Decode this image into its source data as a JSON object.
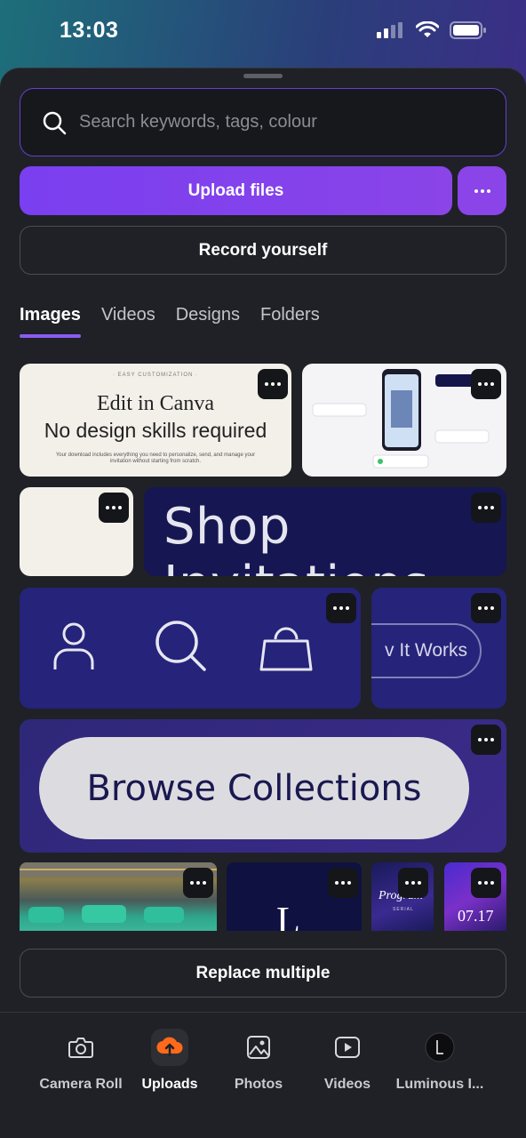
{
  "status_bar": {
    "time": "13:03"
  },
  "search": {
    "placeholder": "Search keywords, tags, colour"
  },
  "actions": {
    "upload_label": "Upload files",
    "record_label": "Record yourself",
    "replace_label": "Replace multiple"
  },
  "tabs": [
    {
      "label": "Images",
      "active": true
    },
    {
      "label": "Videos",
      "active": false
    },
    {
      "label": "Designs",
      "active": false
    },
    {
      "label": "Folders",
      "active": false
    }
  ],
  "thumbnails": {
    "t1": {
      "eyebrow": "· EASY CUSTOMIZATION ·",
      "headline": "Edit in Canva",
      "headline2": "No design skills required",
      "small": "Your download includes everything you need to personalize, send, and manage your invitation without starting from scratch."
    },
    "t4": {
      "text": "Shop Invitations"
    },
    "t6": {
      "text": "v It Works"
    },
    "t7": {
      "text": "Browse Collections"
    },
    "t9": {
      "text": "L"
    },
    "t10": {
      "script": "Program",
      "tiny": "SERIAL"
    },
    "t11": {
      "date": "07.17"
    }
  },
  "bottom_nav": [
    {
      "label": "Camera Roll",
      "icon": "camera-icon",
      "active": false
    },
    {
      "label": "Uploads",
      "icon": "upload-cloud-icon",
      "active": true
    },
    {
      "label": "Photos",
      "icon": "photo-icon",
      "active": false
    },
    {
      "label": "Videos",
      "icon": "video-play-icon",
      "active": false
    },
    {
      "label": "Luminous I...",
      "icon": "brand-logo-icon",
      "active": false
    }
  ],
  "colors": {
    "accent": "#8a44e8",
    "sheet_bg": "#1f2126",
    "upload_icon": "#ff6a1a"
  }
}
